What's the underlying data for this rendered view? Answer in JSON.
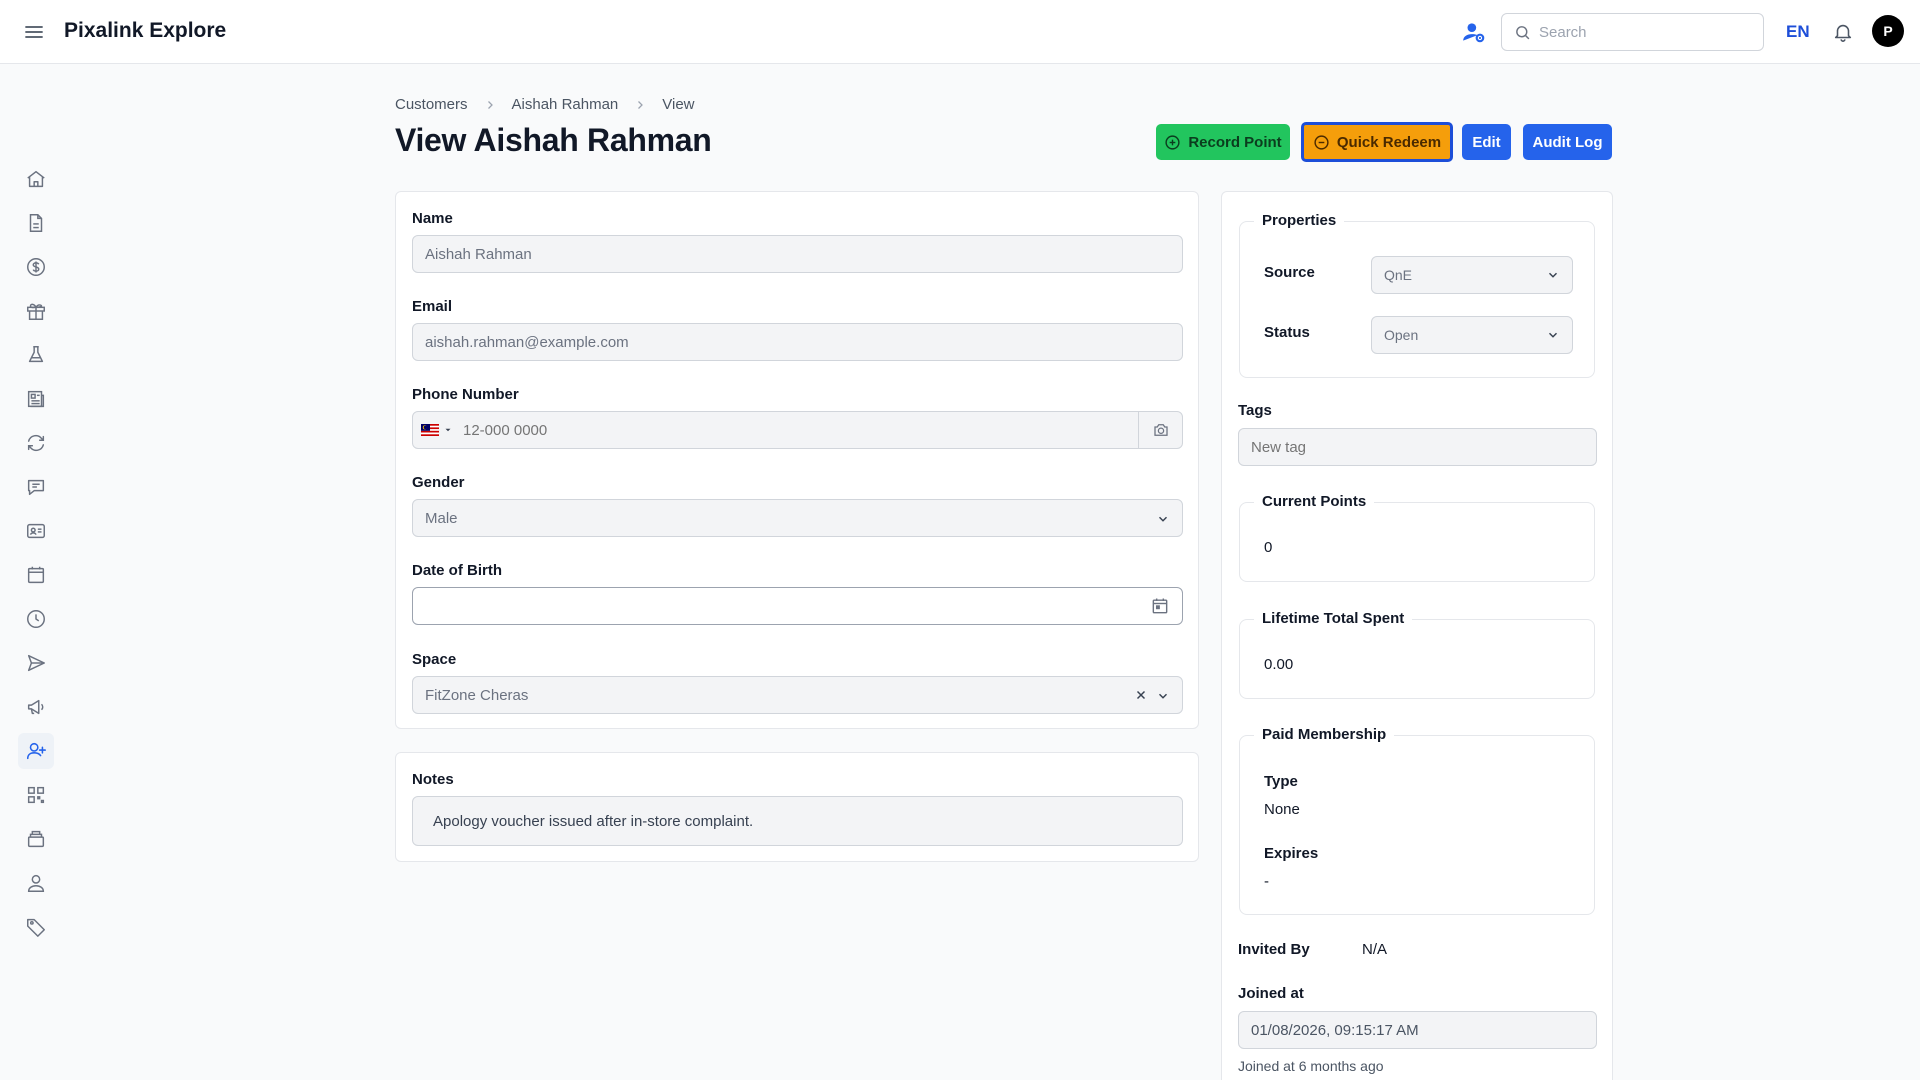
{
  "app": {
    "title": "Pixalink Explore"
  },
  "topbar": {
    "search_placeholder": "Search",
    "language": "EN",
    "avatar_initial": "P"
  },
  "sidebar": {
    "items": [
      {
        "icon": "home-icon"
      },
      {
        "icon": "document-icon"
      },
      {
        "icon": "dollar-icon"
      },
      {
        "icon": "gift-icon"
      },
      {
        "icon": "flask-icon"
      },
      {
        "icon": "newspaper-icon"
      },
      {
        "icon": "refresh-icon"
      },
      {
        "icon": "chat-icon"
      },
      {
        "icon": "id-card-icon"
      },
      {
        "icon": "calendar-icon"
      },
      {
        "icon": "clock-icon"
      },
      {
        "icon": "send-icon"
      },
      {
        "icon": "megaphone-icon"
      },
      {
        "icon": "user-plus-icon",
        "active": true
      },
      {
        "icon": "qr-code-icon"
      },
      {
        "icon": "stack-icon"
      },
      {
        "icon": "user-icon"
      },
      {
        "icon": "tag-icon"
      }
    ]
  },
  "breadcrumb": [
    "Customers",
    "Aishah Rahman",
    "View"
  ],
  "page": {
    "title": "View Aishah Rahman"
  },
  "actions": {
    "record_point": "Record Point",
    "quick_redeem": "Quick Redeem",
    "edit": "Edit",
    "audit_log": "Audit Log"
  },
  "form": {
    "name_label": "Name",
    "name_value": "Aishah Rahman",
    "email_label": "Email",
    "email_value": "aishah.rahman@example.com",
    "phone_label": "Phone Number",
    "phone_placeholder": "12-000 0000",
    "gender_label": "Gender",
    "gender_value": "Male",
    "dob_label": "Date of Birth",
    "dob_value": "",
    "space_label": "Space",
    "space_value": "FitZone Cheras",
    "notes_label": "Notes",
    "notes_value": "Apology voucher issued after in-store complaint."
  },
  "side": {
    "properties_legend": "Properties",
    "source_label": "Source",
    "source_value": "QnE",
    "status_label": "Status",
    "status_value": "Open",
    "tags_label": "Tags",
    "tags_placeholder": "New tag",
    "current_points_legend": "Current Points",
    "current_points_value": "0",
    "lifetime_legend": "Lifetime Total Spent",
    "lifetime_value": "0.00",
    "membership_legend": "Paid Membership",
    "type_label": "Type",
    "type_value": "None",
    "expires_label": "Expires",
    "expires_value": "-",
    "invited_by_label": "Invited By",
    "invited_by_value": "N/A",
    "joined_label": "Joined at",
    "joined_value": "01/08/2026, 09:15:17 AM",
    "joined_relative": "Joined at 6 months ago"
  },
  "colors": {
    "record_point_bg": "#22c55e",
    "quick_redeem_bg": "#f59e0b",
    "primary_blue": "#2563eb"
  }
}
